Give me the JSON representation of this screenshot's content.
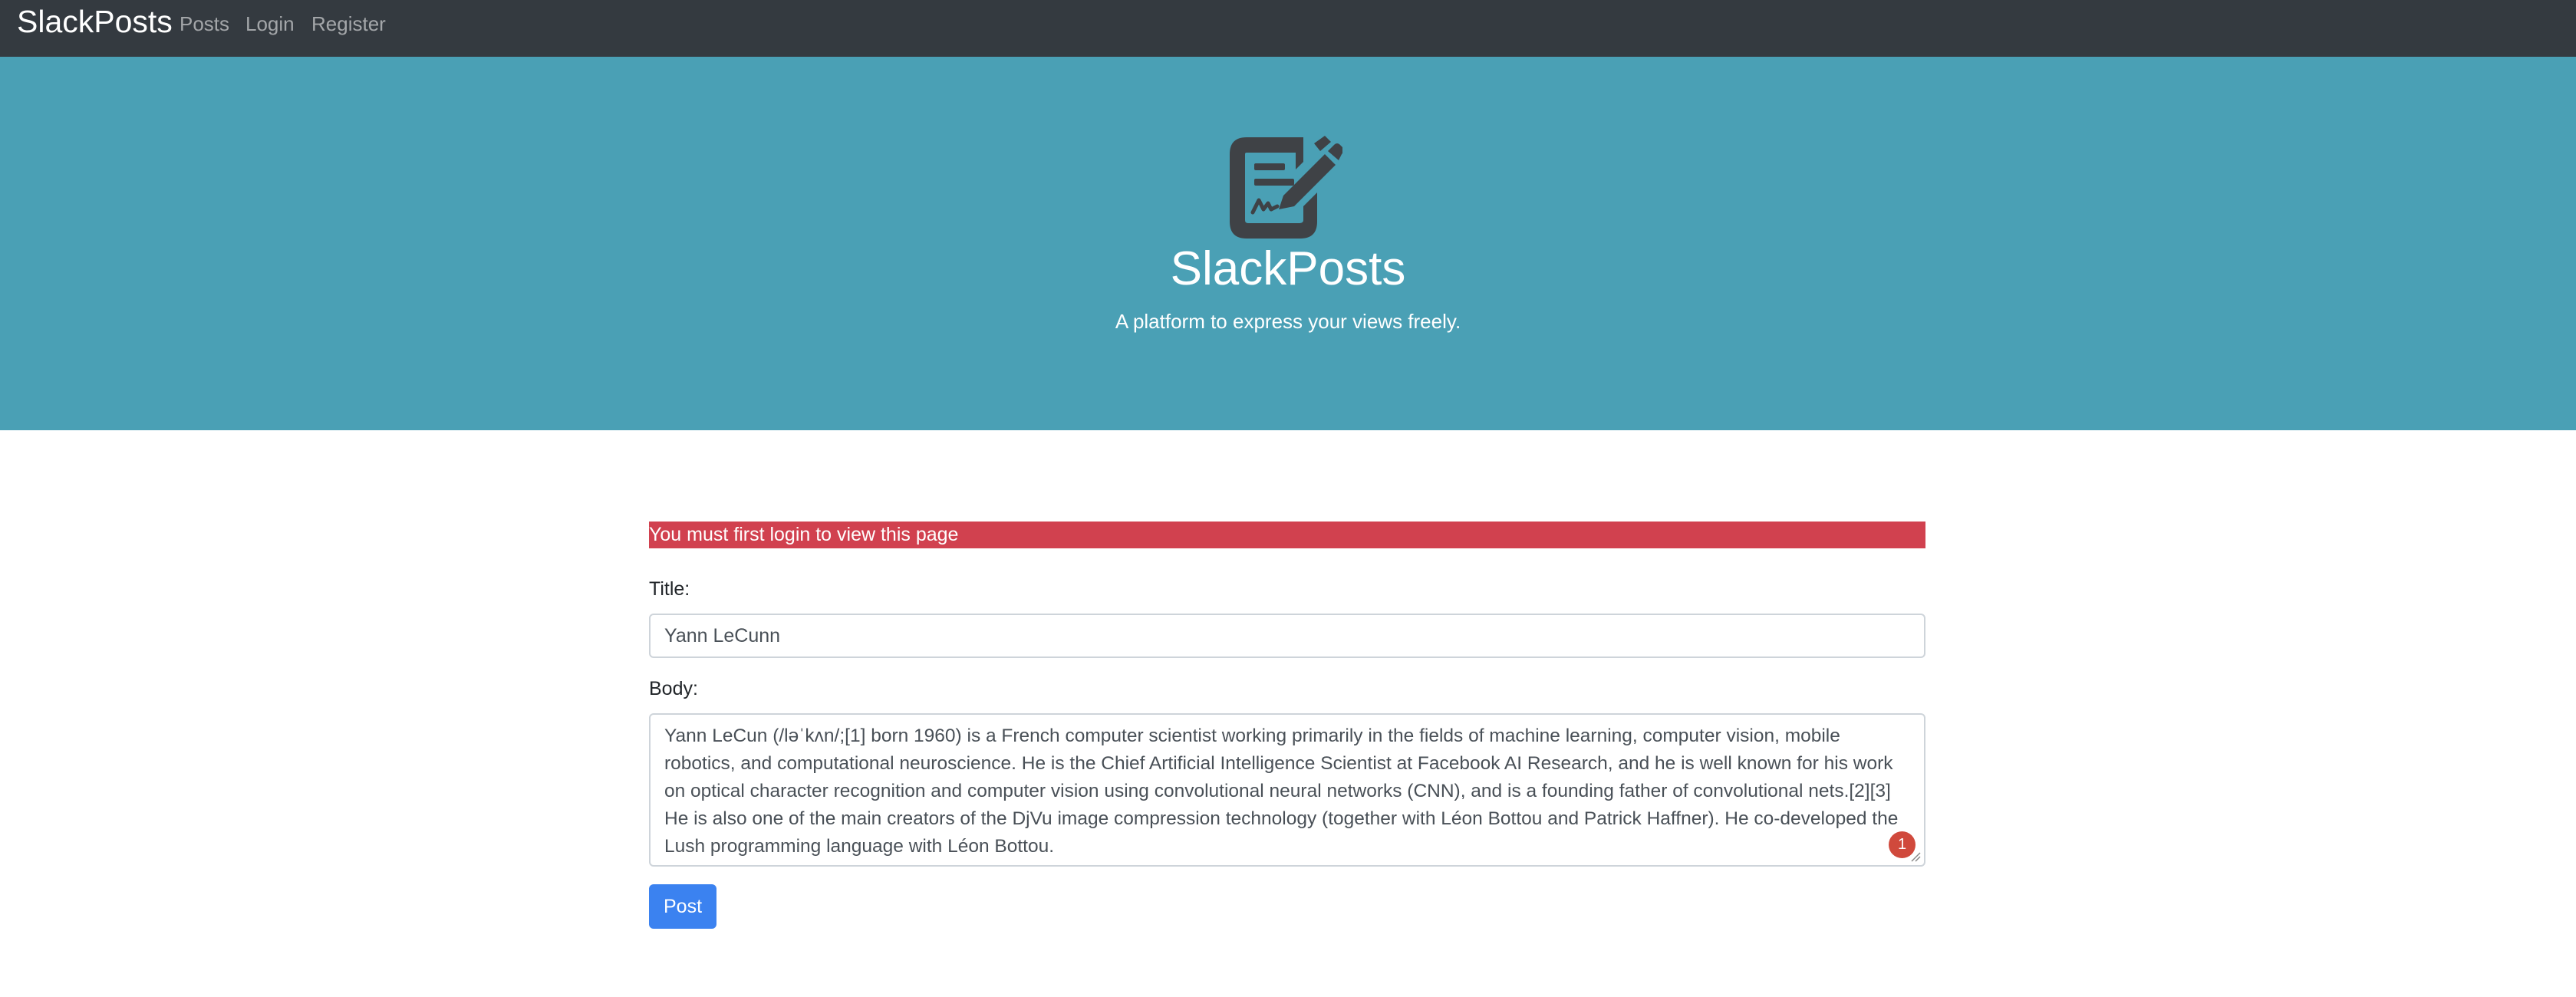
{
  "navbar": {
    "brand": "SlackPosts",
    "links": [
      "Posts",
      "Login",
      "Register"
    ]
  },
  "hero": {
    "icon": "file-signature-icon",
    "title": "SlackPosts",
    "subtitle": "A platform to express your views freely."
  },
  "alert": {
    "message": "You must first login to view this page"
  },
  "form": {
    "title_label": "Title:",
    "title_value": "Yann LeCunn",
    "body_label": "Body:",
    "body_value": "Yann LeCun (/ləˈkʌn/;[1] born 1960) is a French computer scientist working primarily in the fields of machine learning, computer vision, mobile robotics, and computational neuroscience. He is the Chief Artificial Intelligence Scientist at Facebook AI Research, and he is well known for his work on optical character recognition and computer vision using convolutional neural networks (CNN), and is a founding father of convolutional nets.[2][3] He is also one of the main creators of the DjVu image compression technology (together with Léon Bottou and Patrick Haffner). He co-developed the Lush programming language with Léon Bottou.",
    "grammar_badge": "1",
    "submit_label": "Post"
  },
  "colors": {
    "navbar_bg": "#343a40",
    "hero_bg": "#4aa0b5",
    "alert_bg": "#d1414f",
    "primary": "#3b82f0"
  }
}
